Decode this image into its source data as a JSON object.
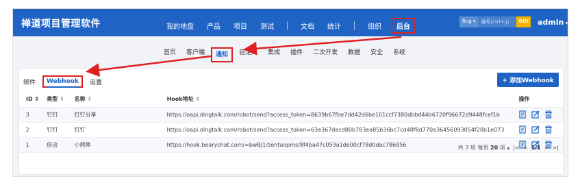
{
  "app": {
    "title": "禅道项目管理软件",
    "user": "admin"
  },
  "topnav": {
    "items": [
      "我的地盘",
      "产品",
      "项目",
      "测试",
      "文档",
      "统计",
      "组织",
      "后台"
    ],
    "search_type": "Bug",
    "search_placeholder": "编号(ctrl+g)",
    "search_go": "GO!"
  },
  "subnav": [
    "首页",
    "客户端",
    "通知",
    "自定义",
    "集成",
    "插件",
    "二次开发",
    "数据",
    "安全",
    "系统"
  ],
  "tabs": [
    "邮件",
    "Webhook",
    "设置"
  ],
  "add_button": "+ 添加Webhook",
  "table": {
    "headers": [
      "ID",
      "类型",
      "名称",
      "Hook地址",
      "操作"
    ],
    "rows": [
      {
        "id": "3",
        "type": "钉钉",
        "name": "钉钉分享",
        "hook": "https://oapi.dingtalk.com/robot/send?access_token=8639b67fbe7dd42d6be101ccf7380dbbd44b6720f96672d9448fcef1b"
      },
      {
        "id": "2",
        "type": "钉钉",
        "name": "钉钉",
        "hook": "https://oapi.dingtalk.com/robot/send?access_token=63e367decd80b783ea85b36bc7cd48f8d770a36456093054f20b1e073"
      },
      {
        "id": "1",
        "type": "倍洽",
        "name": "小熊熊",
        "hook": "https://hook.bearychat.com/=bwBJ1/zentaopms/8f4ba47c059a1de00cf78d0dac786856"
      }
    ]
  },
  "pager": {
    "total": "共 3 项",
    "per_page_label": "每页",
    "per_page": "20",
    "per_page_unit": "项",
    "page": "1/1"
  },
  "colors": {
    "brand": "#1f64c4",
    "highlight": "#e02020",
    "go": "#f5b400"
  }
}
